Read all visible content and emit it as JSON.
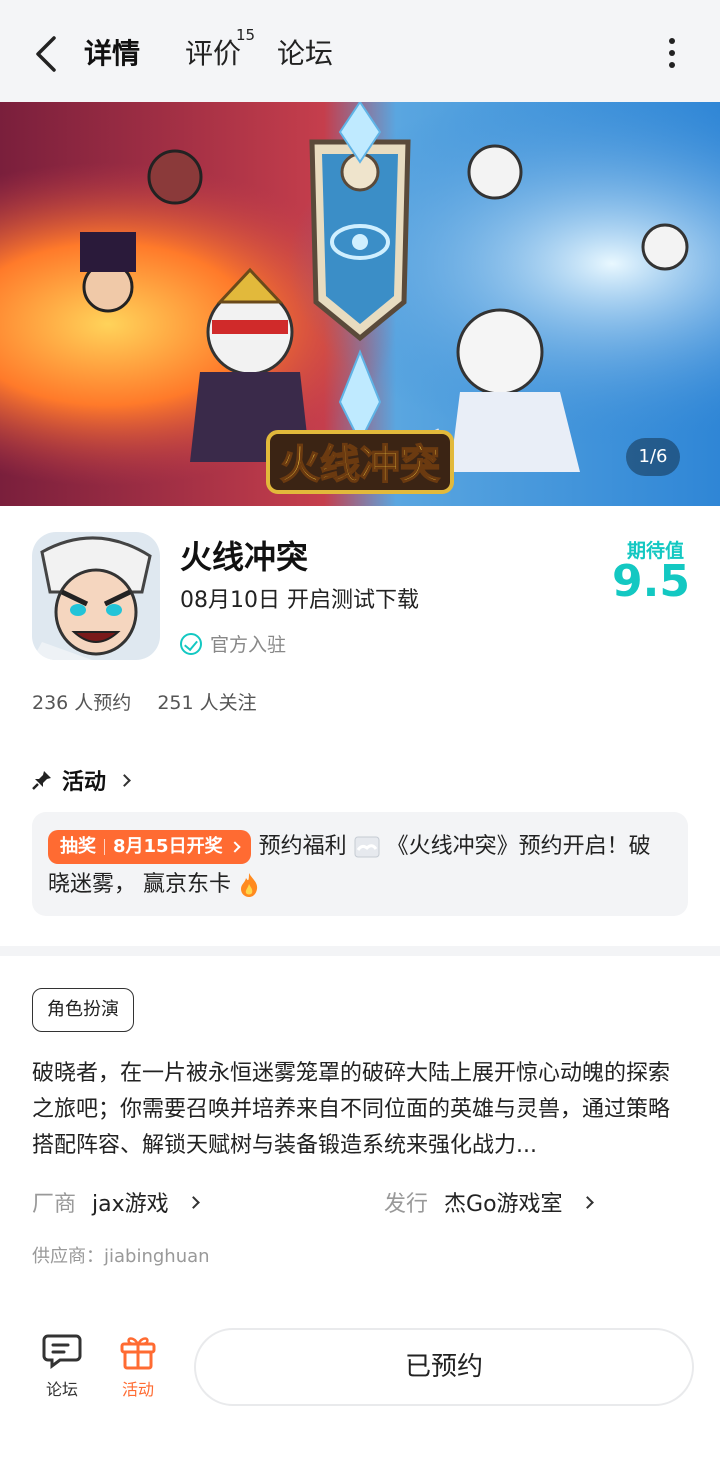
{
  "header": {
    "tabs": [
      {
        "label": "详情",
        "active": true
      },
      {
        "label": "评价",
        "count": "15"
      },
      {
        "label": "论坛"
      }
    ]
  },
  "banner": {
    "logo_text": "火线冲突",
    "pager": "1/6"
  },
  "game": {
    "title": "火线冲突",
    "release": "08月10日 开启测试下载",
    "official": "官方入驻",
    "expect_label": "期待值",
    "expect_score": "9.5",
    "reservations": "236 人预约",
    "followers": "251 人关注"
  },
  "activity": {
    "header": "活动",
    "tag_left": "抽奖",
    "tag_right": "8月15日开奖",
    "text_1": "预约福利",
    "text_2": "《火线冲突》预约开启！破晓迷雾， 赢京东卡"
  },
  "info": {
    "genre": "角色扮演",
    "description": "破晓者，在一片被永恒迷雾笼罩的破碎大陆上展开惊心动魄的探索之旅吧；你需要召唤并培养来自不同位面的英雄与灵兽，通过策略搭配阵容、解锁天赋树与装备锻造系统来强化战力...",
    "developer_key": "厂商",
    "developer": "jax游戏",
    "publisher_key": "发行",
    "publisher": "杰Go游戏室",
    "supplier": "供应商：jiabinghuan"
  },
  "bottom": {
    "forum": "论坛",
    "activity": "活动",
    "reserve": "已预约"
  },
  "colors": {
    "accent": "#13c8c2",
    "orange": "#ff6b32"
  }
}
